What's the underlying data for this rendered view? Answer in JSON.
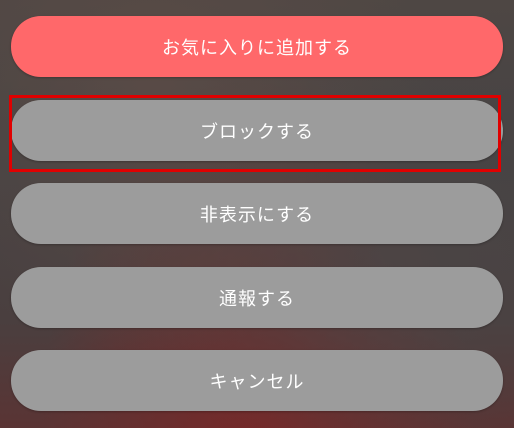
{
  "actions": {
    "favorite_label": "お気に入りに追加する",
    "block_label": "ブロックする",
    "hide_label": "非表示にする",
    "report_label": "通報する",
    "cancel_label": "キャンセル"
  },
  "colors": {
    "primary_button": "#ff686a",
    "secondary_button": "#9c9c9c",
    "highlight_border": "#e00000"
  },
  "highlight": {
    "target": "block-button"
  }
}
